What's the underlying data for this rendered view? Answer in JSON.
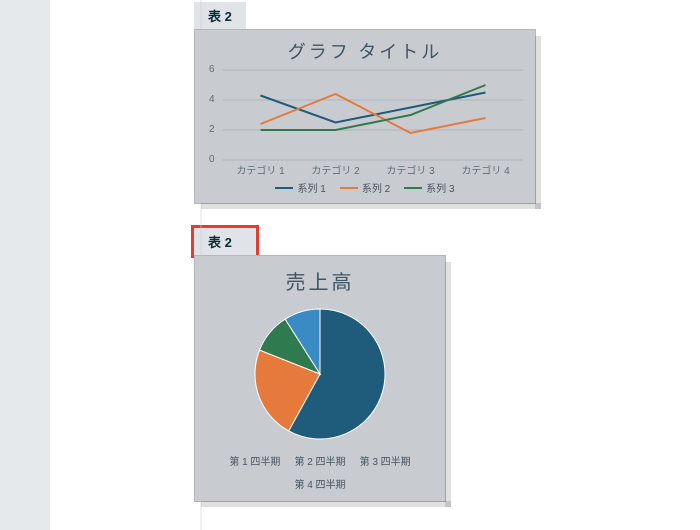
{
  "captions": {
    "chart1": "表 2",
    "chart2": "表 2"
  },
  "colors": {
    "series1": "#1f5b7a",
    "series2": "#e67a3c",
    "series3": "#2f7a4f",
    "pie_q4": "#3a8bc4",
    "highlight": "#e53c31"
  },
  "chart_data": [
    {
      "type": "line",
      "title": "グラフ タイトル",
      "xlabel": "",
      "ylabel": "",
      "ylim": [
        0,
        6
      ],
      "yticks": [
        0,
        2,
        4,
        6
      ],
      "categories": [
        "カテゴリ 1",
        "カテゴリ 2",
        "カテゴリ 3",
        "カテゴリ 4"
      ],
      "series": [
        {
          "name": "系列 1",
          "values": [
            4.3,
            2.5,
            3.5,
            4.5
          ]
        },
        {
          "name": "系列 2",
          "values": [
            2.4,
            4.4,
            1.8,
            2.8
          ]
        },
        {
          "name": "系列 3",
          "values": [
            2.0,
            2.0,
            3.0,
            5.0
          ]
        }
      ],
      "legend_position": "bottom",
      "grid": true
    },
    {
      "type": "pie",
      "title": "売上高",
      "series": [
        {
          "name": "第 1 四半期",
          "value": 58
        },
        {
          "name": "第 2 四半期",
          "value": 23
        },
        {
          "name": "第 3 四半期",
          "value": 10
        },
        {
          "name": "第 4 四半期",
          "value": 9
        }
      ],
      "legend_position": "bottom"
    }
  ]
}
